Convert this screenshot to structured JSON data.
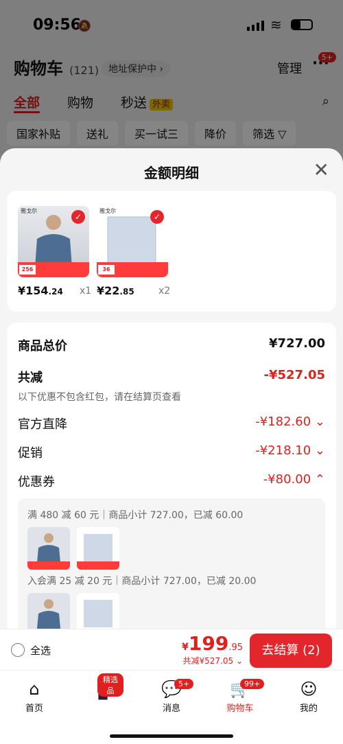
{
  "status": {
    "time": "09:56"
  },
  "header": {
    "title": "购物车",
    "count": "(121)",
    "address": "地址保护中 ›",
    "manage": "管理",
    "more_badge": "5+"
  },
  "tabs": [
    {
      "label": "全部"
    },
    {
      "label": "购物"
    },
    {
      "label": "秒送"
    }
  ],
  "tabs_tag": "外卖",
  "chips": [
    "国家补贴",
    "送礼",
    "买一试三",
    "降价",
    "筛选"
  ],
  "sheet": {
    "title": "金额明细"
  },
  "products": [
    {
      "brand": "雅戈尔",
      "yen": "¥",
      "price_int": "154",
      "price_dec": ".24",
      "qty": "x1",
      "banner": "256"
    },
    {
      "brand": "雅戈尔",
      "yen": "¥",
      "price_int": "22",
      "price_dec": ".85",
      "qty": "x2",
      "banner": "36"
    }
  ],
  "summary": {
    "total_label": "商品总价",
    "total_value": "¥727.00",
    "discount_label": "共减",
    "discount_value": "-¥527.05",
    "note": "以下优惠不包含红包，请在结算页查看",
    "items": [
      {
        "label": "官方直降",
        "value": "-¥182.60",
        "chev": "⌄"
      },
      {
        "label": "促销",
        "value": "-¥218.10",
        "chev": "⌄"
      },
      {
        "label": "优惠券",
        "value": "-¥80.00",
        "chev": "⌃"
      }
    ],
    "coupons": [
      {
        "text": "满 480 减 60 元｜商品小计 727.00，已减 60.00"
      },
      {
        "text": "入会满 25 减 20 元｜商品小计 727.00，已减 20.00"
      }
    ]
  },
  "bottom": {
    "select_all": "全选",
    "yen": "¥",
    "price_int": "199",
    "price_dec": ".95",
    "discount_note": "共减¥527.05",
    "checkout": "去结算 (2)"
  },
  "nav": [
    {
      "label": "首页",
      "icon": "home-icon",
      "glyph": "⌂"
    },
    {
      "label": "",
      "icon": "phone-promo-icon",
      "glyph": "▮",
      "badge": "精选品"
    },
    {
      "label": "消息",
      "icon": "message-icon",
      "glyph": "💬",
      "badge": "5+"
    },
    {
      "label": "购物车",
      "icon": "cart-icon",
      "glyph": "🛒",
      "badge": "99+"
    },
    {
      "label": "我的",
      "icon": "user-icon",
      "glyph": "☺"
    }
  ],
  "colors": {
    "accent": "#e3262b",
    "text_red": "#e0201c"
  }
}
